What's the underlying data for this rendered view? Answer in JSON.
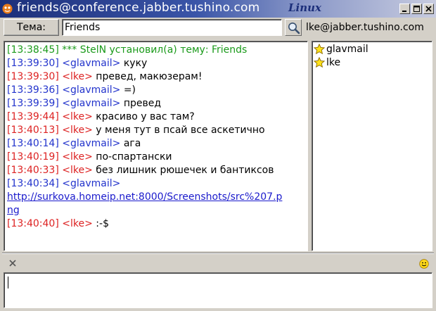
{
  "window": {
    "title": "friends@conference.jabber.tushino.com",
    "wm_brand": "Linux",
    "buttons": [
      "minimize",
      "maximize",
      "close"
    ]
  },
  "topic_bar": {
    "topic_button_label": "Тема:",
    "topic_value": "Friends",
    "own_jid": "lke@jabber.tushino.com"
  },
  "chat": {
    "messages": [
      {
        "time": "[13:38:45]",
        "nick": "***",
        "text": "StelN установил(а) тему: Friends",
        "kind": "system"
      },
      {
        "time": "[13:39:30]",
        "nick": "<glavmail>",
        "text": "куку",
        "kind": "other"
      },
      {
        "time": "[13:39:30]",
        "nick": "<lke>",
        "text": "превед, макюзерам!",
        "kind": "self"
      },
      {
        "time": "[13:39:36]",
        "nick": "<glavmail>",
        "text": "=)",
        "kind": "other"
      },
      {
        "time": "[13:39:39]",
        "nick": "<glavmail>",
        "text": "превед",
        "kind": "other"
      },
      {
        "time": "[13:39:44]",
        "nick": "<lke>",
        "text": "красиво у вас там?",
        "kind": "self"
      },
      {
        "time": "[13:40:13]",
        "nick": "<lke>",
        "text": "у меня тут в псай все аскетично",
        "kind": "self"
      },
      {
        "time": "[13:40:14]",
        "nick": "<glavmail>",
        "text": "ага",
        "kind": "other"
      },
      {
        "time": "[13:40:19]",
        "nick": "<lke>",
        "text": "по-спартански",
        "kind": "self"
      },
      {
        "time": "[13:40:33]",
        "nick": "<lke>",
        "text": "без лишник рюшечек и бантиксов",
        "kind": "self"
      },
      {
        "time": "[13:40:34]",
        "nick": "<glavmail>",
        "text": "",
        "kind": "other"
      },
      {
        "link_line1": "http://surkova.homeip.net:8000/Screenshots/src%207.p",
        "link_line2": "ng",
        "kind": "link"
      },
      {
        "time": "[13:40:40]",
        "nick": "<lke>",
        "text": ":-$",
        "kind": "self"
      }
    ]
  },
  "roster": {
    "items": [
      {
        "name": "glavmail",
        "icon": "star-icon"
      },
      {
        "name": "lke",
        "icon": "star-icon"
      }
    ]
  },
  "composer": {
    "value": ""
  },
  "colors": {
    "system": "#1a9a1a",
    "other": "#2233cc",
    "self": "#dd2222",
    "link": "#1a1acc",
    "titlebar": "#1c2f7a"
  }
}
